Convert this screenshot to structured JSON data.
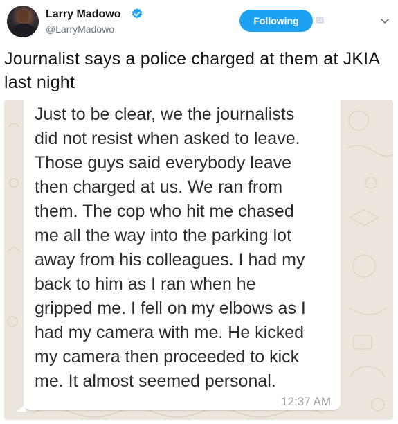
{
  "tweet": {
    "author_name": "Larry Madowo",
    "handle": "@LarryMadowo",
    "follow_label": "Following",
    "text": "Journalist says a police charged at them at JKIA last night"
  },
  "media": {
    "message_text": "Just to be clear, we the journalists\ndid not resist when asked to leave.\nThose guys said everybody leave\nthen charged at us. We ran from\nthem. The cop who hit me chased\nme all the way into the parking lot\naway from his colleagues. I had my\nback to him as I ran when he\ngripped me. I fell on my elbows as I\nhad my camera with me. He kicked\nmy camera then proceeded to kick\nme. It almost seemed personal.",
    "timestamp": "12:37 AM"
  },
  "icons": {
    "verified": "verified-badge-icon",
    "notifications": "notification-bell-icon",
    "more": "chevron-down-icon"
  },
  "colors": {
    "accent": "#1da1f2",
    "chat_background": "#ece5dd",
    "bubble": "#ffffff"
  }
}
